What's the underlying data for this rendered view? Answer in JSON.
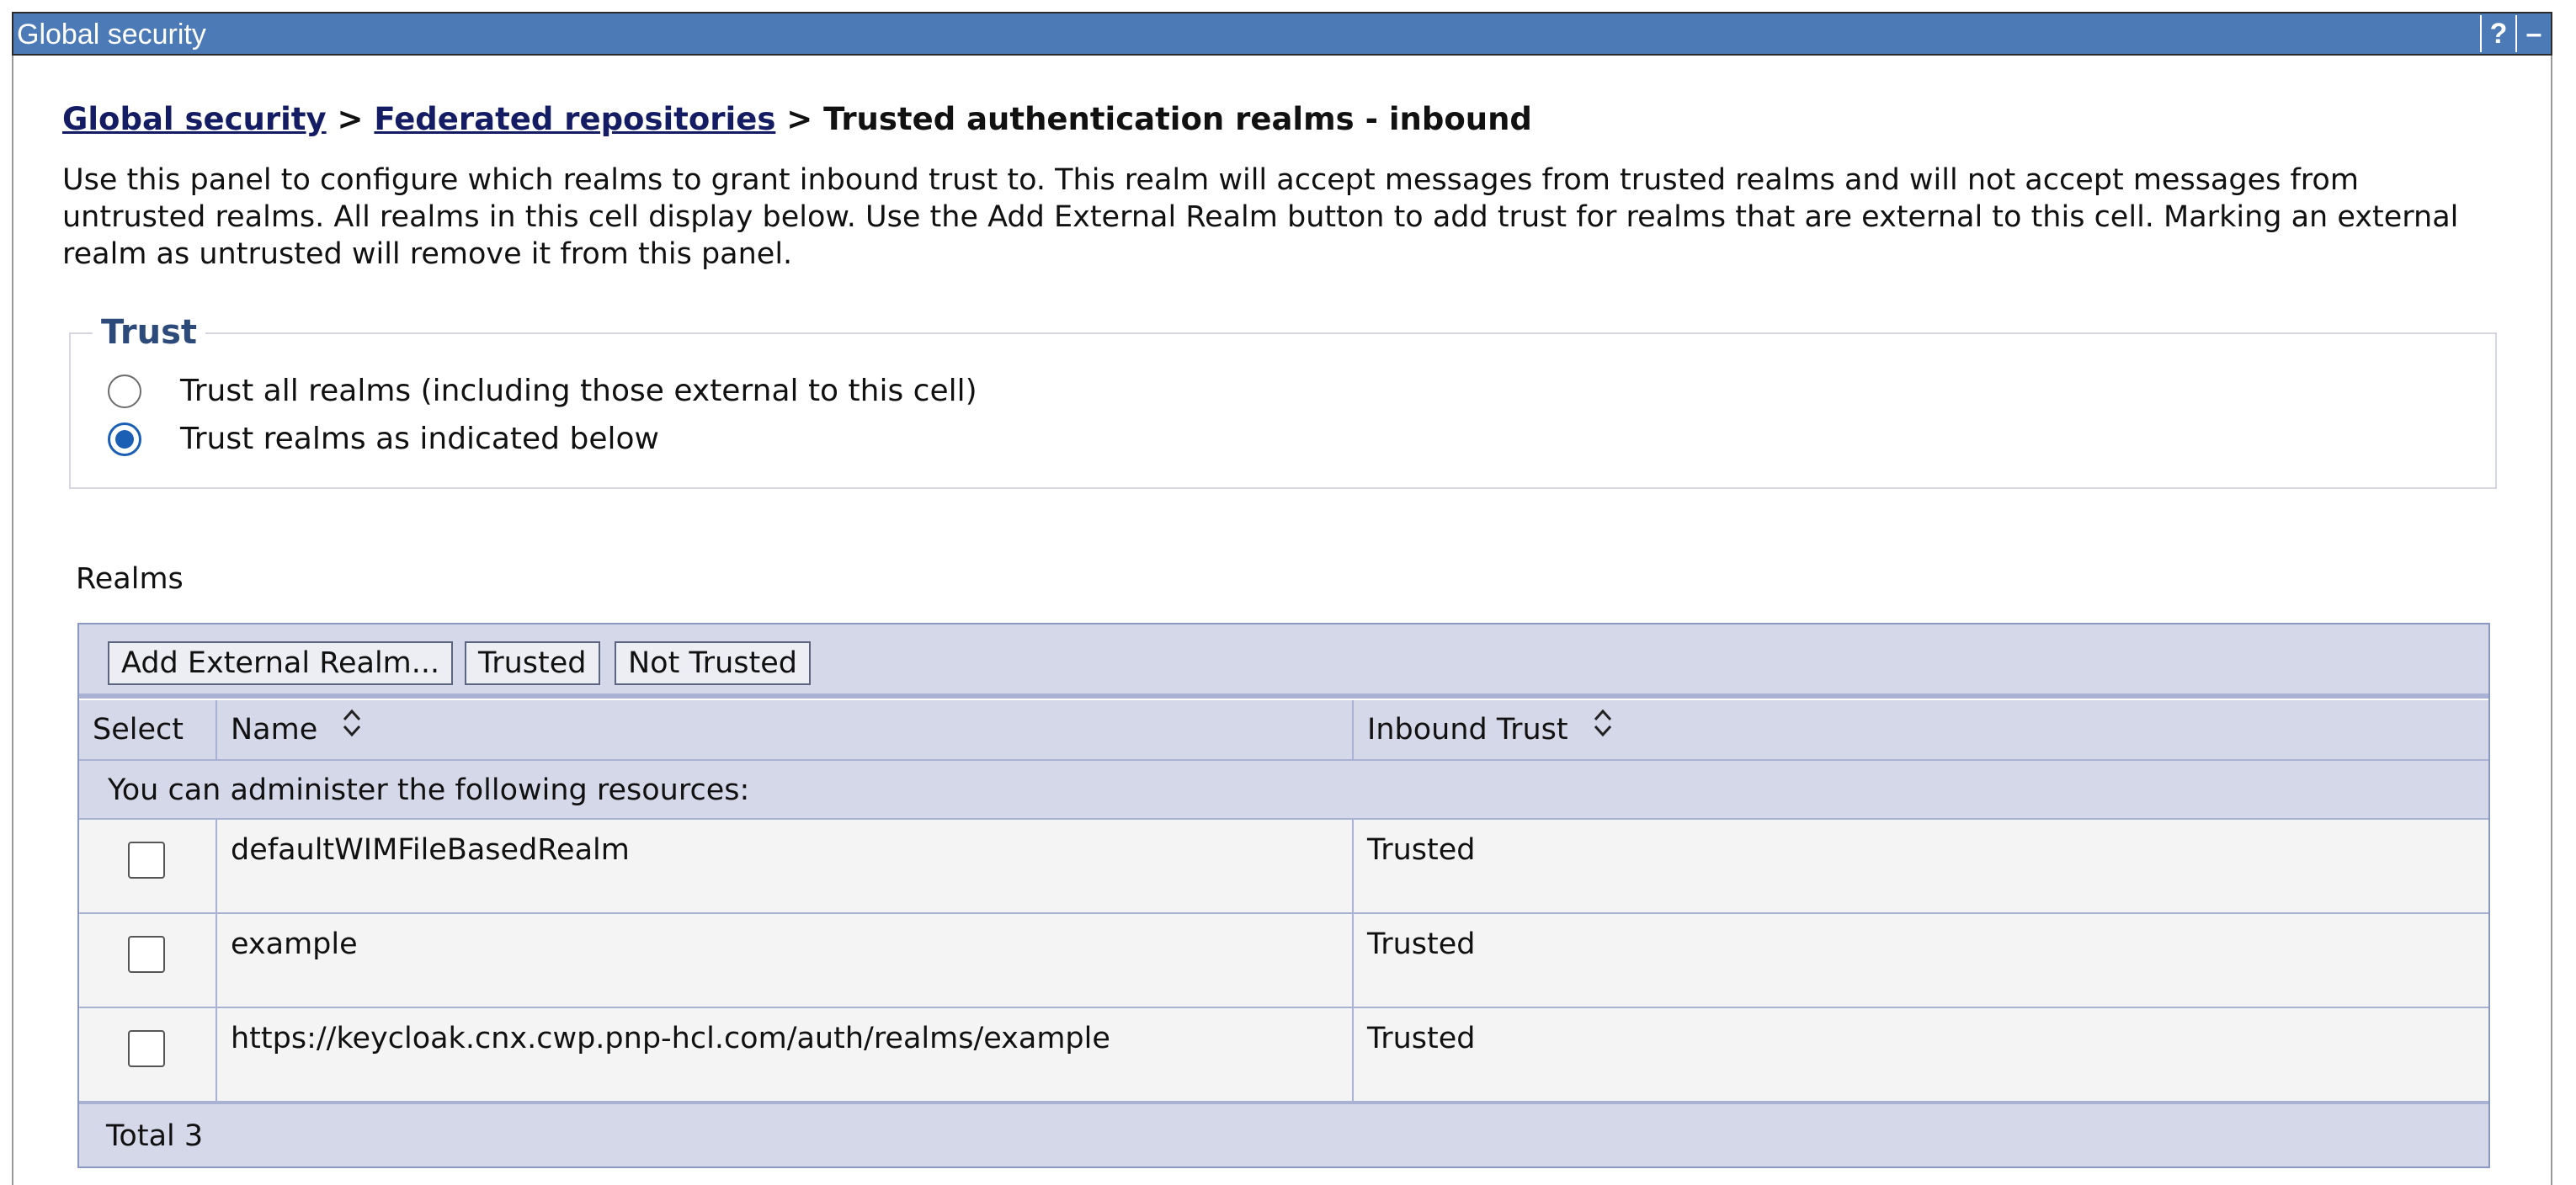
{
  "window": {
    "title": "Global security",
    "help_label": "?",
    "minimize_label": "–"
  },
  "breadcrumb": {
    "link1": "Global security",
    "sep1": ">",
    "link2": "Federated repositories",
    "sep2": ">",
    "current": "Trusted authentication realms - inbound"
  },
  "description": "Use this panel to configure which realms to grant inbound trust to. This realm will accept messages from trusted realms and will not accept messages from untrusted realms. All realms in this cell display below. Use the Add External Realm button to add trust for realms that are external to this cell. Marking an external realm as untrusted will remove it from this panel.",
  "trust": {
    "legend": "Trust",
    "options": [
      {
        "label": "Trust all realms (including those external to this cell)",
        "checked": false
      },
      {
        "label": "Trust realms as indicated below",
        "checked": true
      }
    ]
  },
  "realms": {
    "label": "Realms",
    "toolbar": {
      "add_label": "Add External Realm...",
      "trusted_label": "Trusted",
      "not_trusted_label": "Not Trusted"
    },
    "columns": {
      "select": "Select",
      "name": "Name",
      "inbound": "Inbound Trust"
    },
    "resources_note": "You can administer the following resources:",
    "rows": [
      {
        "name": "defaultWIMFileBasedRealm",
        "trust": "Trusted"
      },
      {
        "name": "example",
        "trust": "Trusted"
      },
      {
        "name": "https://keycloak.cnx.cwp.pnp-hcl.com/auth/realms/example",
        "trust": "Trusted"
      }
    ],
    "total": "Total 3"
  }
}
